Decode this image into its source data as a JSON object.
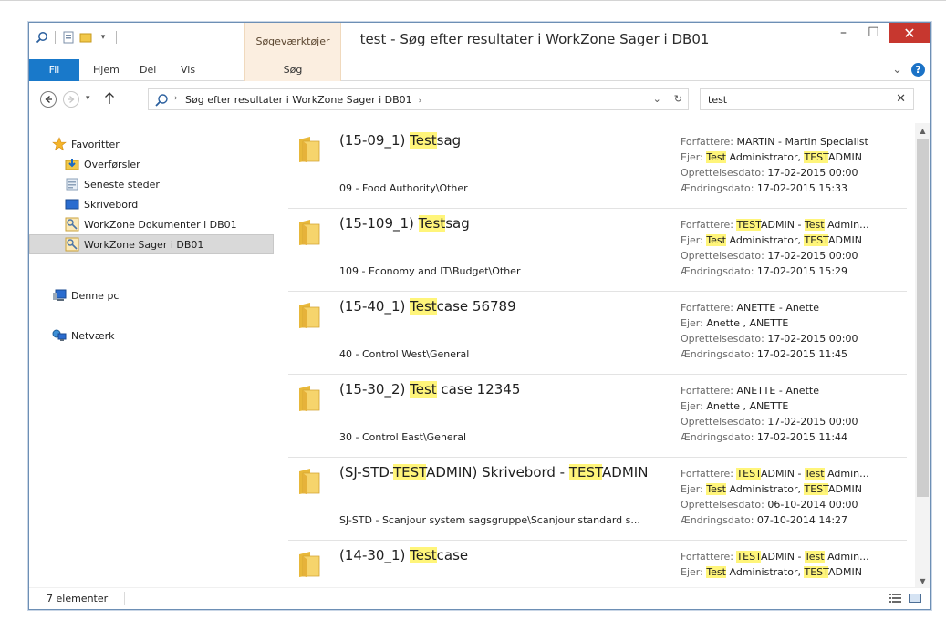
{
  "window": {
    "title": "test - Søg efter resultater i WorkZone Sager i DB01",
    "context_tab_group": "Søgeværktøjer",
    "controls": {
      "minimize": "–",
      "maximize": "☐",
      "close": "✕"
    }
  },
  "ribbon": {
    "tabs": [
      "Fil",
      "Hjem",
      "Del",
      "Vis",
      "Søg"
    ],
    "expand_glyph": "⌄",
    "help_glyph": "?"
  },
  "address": {
    "path": "Søg efter resultater i WorkZone Sager i DB01",
    "separator": "›",
    "dropdown_glyph": "⌄",
    "refresh_glyph": "↻"
  },
  "search": {
    "value": "test",
    "clear_glyph": "✕"
  },
  "nav": {
    "favorites_label": "Favoritter",
    "favorites": [
      "Overførsler",
      "Seneste steder",
      "Skrivebord",
      "WorkZone Dokumenter i DB01",
      "WorkZone Sager i DB01"
    ],
    "this_pc": "Denne pc",
    "network": "Netværk"
  },
  "labels": {
    "authors": "Forfattere:",
    "owner": "Ejer:",
    "created": "Oprettelsesdato:",
    "modified": "Ændringsdato:"
  },
  "results": [
    {
      "title_parts": [
        {
          "t": "(15-09_1) "
        },
        {
          "t": "Test",
          "hl": true
        },
        {
          "t": "sag"
        }
      ],
      "path": "09 - Food Authority\\Other",
      "authors_parts": [
        {
          "t": "MARTIN - Martin Specialist"
        }
      ],
      "owner_parts": [
        {
          "t": "Test",
          "hl": true
        },
        {
          "t": " Administrator, "
        },
        {
          "t": "TEST",
          "hl": true
        },
        {
          "t": "ADMIN"
        }
      ],
      "created": "17-02-2015 00:00",
      "modified": "17-02-2015 15:33"
    },
    {
      "title_parts": [
        {
          "t": "(15-109_1) "
        },
        {
          "t": "Test",
          "hl": true
        },
        {
          "t": "sag"
        }
      ],
      "path": "109 - Economy and IT\\Budget\\Other",
      "authors_parts": [
        {
          "t": "TEST",
          "hl": true
        },
        {
          "t": "ADMIN - "
        },
        {
          "t": "Test",
          "hl": true
        },
        {
          "t": " Admin..."
        }
      ],
      "owner_parts": [
        {
          "t": "Test",
          "hl": true
        },
        {
          "t": " Administrator, "
        },
        {
          "t": "TEST",
          "hl": true
        },
        {
          "t": "ADMIN"
        }
      ],
      "created": "17-02-2015 00:00",
      "modified": "17-02-2015 15:29"
    },
    {
      "title_parts": [
        {
          "t": "(15-40_1) "
        },
        {
          "t": "Test",
          "hl": true
        },
        {
          "t": "case 56789"
        }
      ],
      "path": "40 - Control West\\General",
      "authors_parts": [
        {
          "t": "ANETTE - Anette"
        }
      ],
      "owner_parts": [
        {
          "t": "Anette , ANETTE"
        }
      ],
      "created": "17-02-2015 00:00",
      "modified": "17-02-2015 11:45"
    },
    {
      "title_parts": [
        {
          "t": "(15-30_2) "
        },
        {
          "t": "Test",
          "hl": true
        },
        {
          "t": " case 12345"
        }
      ],
      "path": "30 - Control East\\General",
      "authors_parts": [
        {
          "t": "ANETTE - Anette"
        }
      ],
      "owner_parts": [
        {
          "t": "Anette , ANETTE"
        }
      ],
      "created": "17-02-2015 00:00",
      "modified": "17-02-2015 11:44"
    },
    {
      "title_parts": [
        {
          "t": "(SJ-STD-"
        },
        {
          "t": "TEST",
          "hl": true
        },
        {
          "t": "ADMIN) Skrivebord - "
        },
        {
          "t": "TEST",
          "hl": true
        },
        {
          "t": "ADMIN"
        }
      ],
      "path": "SJ-STD - Scanjour system sagsgruppe\\Scanjour standard s...",
      "authors_parts": [
        {
          "t": "TEST",
          "hl": true
        },
        {
          "t": "ADMIN - "
        },
        {
          "t": "Test",
          "hl": true
        },
        {
          "t": " Admin..."
        }
      ],
      "owner_parts": [
        {
          "t": "Test",
          "hl": true
        },
        {
          "t": " Administrator, "
        },
        {
          "t": "TEST",
          "hl": true
        },
        {
          "t": "ADMIN"
        }
      ],
      "created": "06-10-2014 00:00",
      "modified": "07-10-2014 14:27"
    },
    {
      "title_parts": [
        {
          "t": "(14-30_1) "
        },
        {
          "t": "Test",
          "hl": true
        },
        {
          "t": "case"
        }
      ],
      "path": "",
      "authors_parts": [
        {
          "t": "TEST",
          "hl": true
        },
        {
          "t": "ADMIN - "
        },
        {
          "t": "Test",
          "hl": true
        },
        {
          "t": " Admin..."
        }
      ],
      "owner_parts": [
        {
          "t": "Test",
          "hl": true
        },
        {
          "t": " Administrator, "
        },
        {
          "t": "TEST",
          "hl": true
        },
        {
          "t": "ADMIN"
        }
      ],
      "created": "",
      "modified": ""
    }
  ],
  "status": {
    "count": "7 elementer"
  },
  "colors": {
    "accent": "#1979ca",
    "highlight": "#fff57a",
    "close": "#c7372f",
    "context_tab": "#fbeee0"
  },
  "icons": [
    "search-icon",
    "folder-icon",
    "star-icon",
    "download-icon",
    "recent-places-icon",
    "desktop-icon",
    "workzone-icon",
    "computer-icon",
    "network-icon"
  ]
}
